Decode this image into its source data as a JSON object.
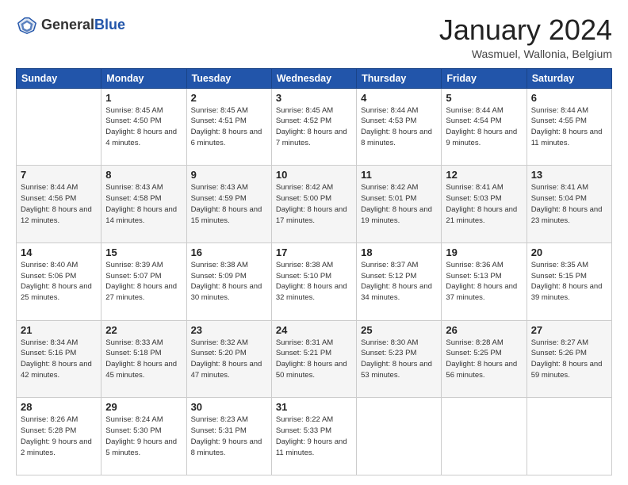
{
  "header": {
    "logo_line1": "General",
    "logo_line2": "Blue",
    "month": "January 2024",
    "location": "Wasmuel, Wallonia, Belgium"
  },
  "weekdays": [
    "Sunday",
    "Monday",
    "Tuesday",
    "Wednesday",
    "Thursday",
    "Friday",
    "Saturday"
  ],
  "rows": [
    [
      {
        "day": "",
        "sunrise": "",
        "sunset": "",
        "daylight": ""
      },
      {
        "day": "1",
        "sunrise": "Sunrise: 8:45 AM",
        "sunset": "Sunset: 4:50 PM",
        "daylight": "Daylight: 8 hours and 4 minutes."
      },
      {
        "day": "2",
        "sunrise": "Sunrise: 8:45 AM",
        "sunset": "Sunset: 4:51 PM",
        "daylight": "Daylight: 8 hours and 6 minutes."
      },
      {
        "day": "3",
        "sunrise": "Sunrise: 8:45 AM",
        "sunset": "Sunset: 4:52 PM",
        "daylight": "Daylight: 8 hours and 7 minutes."
      },
      {
        "day": "4",
        "sunrise": "Sunrise: 8:44 AM",
        "sunset": "Sunset: 4:53 PM",
        "daylight": "Daylight: 8 hours and 8 minutes."
      },
      {
        "day": "5",
        "sunrise": "Sunrise: 8:44 AM",
        "sunset": "Sunset: 4:54 PM",
        "daylight": "Daylight: 8 hours and 9 minutes."
      },
      {
        "day": "6",
        "sunrise": "Sunrise: 8:44 AM",
        "sunset": "Sunset: 4:55 PM",
        "daylight": "Daylight: 8 hours and 11 minutes."
      }
    ],
    [
      {
        "day": "7",
        "sunrise": "Sunrise: 8:44 AM",
        "sunset": "Sunset: 4:56 PM",
        "daylight": "Daylight: 8 hours and 12 minutes."
      },
      {
        "day": "8",
        "sunrise": "Sunrise: 8:43 AM",
        "sunset": "Sunset: 4:58 PM",
        "daylight": "Daylight: 8 hours and 14 minutes."
      },
      {
        "day": "9",
        "sunrise": "Sunrise: 8:43 AM",
        "sunset": "Sunset: 4:59 PM",
        "daylight": "Daylight: 8 hours and 15 minutes."
      },
      {
        "day": "10",
        "sunrise": "Sunrise: 8:42 AM",
        "sunset": "Sunset: 5:00 PM",
        "daylight": "Daylight: 8 hours and 17 minutes."
      },
      {
        "day": "11",
        "sunrise": "Sunrise: 8:42 AM",
        "sunset": "Sunset: 5:01 PM",
        "daylight": "Daylight: 8 hours and 19 minutes."
      },
      {
        "day": "12",
        "sunrise": "Sunrise: 8:41 AM",
        "sunset": "Sunset: 5:03 PM",
        "daylight": "Daylight: 8 hours and 21 minutes."
      },
      {
        "day": "13",
        "sunrise": "Sunrise: 8:41 AM",
        "sunset": "Sunset: 5:04 PM",
        "daylight": "Daylight: 8 hours and 23 minutes."
      }
    ],
    [
      {
        "day": "14",
        "sunrise": "Sunrise: 8:40 AM",
        "sunset": "Sunset: 5:06 PM",
        "daylight": "Daylight: 8 hours and 25 minutes."
      },
      {
        "day": "15",
        "sunrise": "Sunrise: 8:39 AM",
        "sunset": "Sunset: 5:07 PM",
        "daylight": "Daylight: 8 hours and 27 minutes."
      },
      {
        "day": "16",
        "sunrise": "Sunrise: 8:38 AM",
        "sunset": "Sunset: 5:09 PM",
        "daylight": "Daylight: 8 hours and 30 minutes."
      },
      {
        "day": "17",
        "sunrise": "Sunrise: 8:38 AM",
        "sunset": "Sunset: 5:10 PM",
        "daylight": "Daylight: 8 hours and 32 minutes."
      },
      {
        "day": "18",
        "sunrise": "Sunrise: 8:37 AM",
        "sunset": "Sunset: 5:12 PM",
        "daylight": "Daylight: 8 hours and 34 minutes."
      },
      {
        "day": "19",
        "sunrise": "Sunrise: 8:36 AM",
        "sunset": "Sunset: 5:13 PM",
        "daylight": "Daylight: 8 hours and 37 minutes."
      },
      {
        "day": "20",
        "sunrise": "Sunrise: 8:35 AM",
        "sunset": "Sunset: 5:15 PM",
        "daylight": "Daylight: 8 hours and 39 minutes."
      }
    ],
    [
      {
        "day": "21",
        "sunrise": "Sunrise: 8:34 AM",
        "sunset": "Sunset: 5:16 PM",
        "daylight": "Daylight: 8 hours and 42 minutes."
      },
      {
        "day": "22",
        "sunrise": "Sunrise: 8:33 AM",
        "sunset": "Sunset: 5:18 PM",
        "daylight": "Daylight: 8 hours and 45 minutes."
      },
      {
        "day": "23",
        "sunrise": "Sunrise: 8:32 AM",
        "sunset": "Sunset: 5:20 PM",
        "daylight": "Daylight: 8 hours and 47 minutes."
      },
      {
        "day": "24",
        "sunrise": "Sunrise: 8:31 AM",
        "sunset": "Sunset: 5:21 PM",
        "daylight": "Daylight: 8 hours and 50 minutes."
      },
      {
        "day": "25",
        "sunrise": "Sunrise: 8:30 AM",
        "sunset": "Sunset: 5:23 PM",
        "daylight": "Daylight: 8 hours and 53 minutes."
      },
      {
        "day": "26",
        "sunrise": "Sunrise: 8:28 AM",
        "sunset": "Sunset: 5:25 PM",
        "daylight": "Daylight: 8 hours and 56 minutes."
      },
      {
        "day": "27",
        "sunrise": "Sunrise: 8:27 AM",
        "sunset": "Sunset: 5:26 PM",
        "daylight": "Daylight: 8 hours and 59 minutes."
      }
    ],
    [
      {
        "day": "28",
        "sunrise": "Sunrise: 8:26 AM",
        "sunset": "Sunset: 5:28 PM",
        "daylight": "Daylight: 9 hours and 2 minutes."
      },
      {
        "day": "29",
        "sunrise": "Sunrise: 8:24 AM",
        "sunset": "Sunset: 5:30 PM",
        "daylight": "Daylight: 9 hours and 5 minutes."
      },
      {
        "day": "30",
        "sunrise": "Sunrise: 8:23 AM",
        "sunset": "Sunset: 5:31 PM",
        "daylight": "Daylight: 9 hours and 8 minutes."
      },
      {
        "day": "31",
        "sunrise": "Sunrise: 8:22 AM",
        "sunset": "Sunset: 5:33 PM",
        "daylight": "Daylight: 9 hours and 11 minutes."
      },
      {
        "day": "",
        "sunrise": "",
        "sunset": "",
        "daylight": ""
      },
      {
        "day": "",
        "sunrise": "",
        "sunset": "",
        "daylight": ""
      },
      {
        "day": "",
        "sunrise": "",
        "sunset": "",
        "daylight": ""
      }
    ]
  ]
}
